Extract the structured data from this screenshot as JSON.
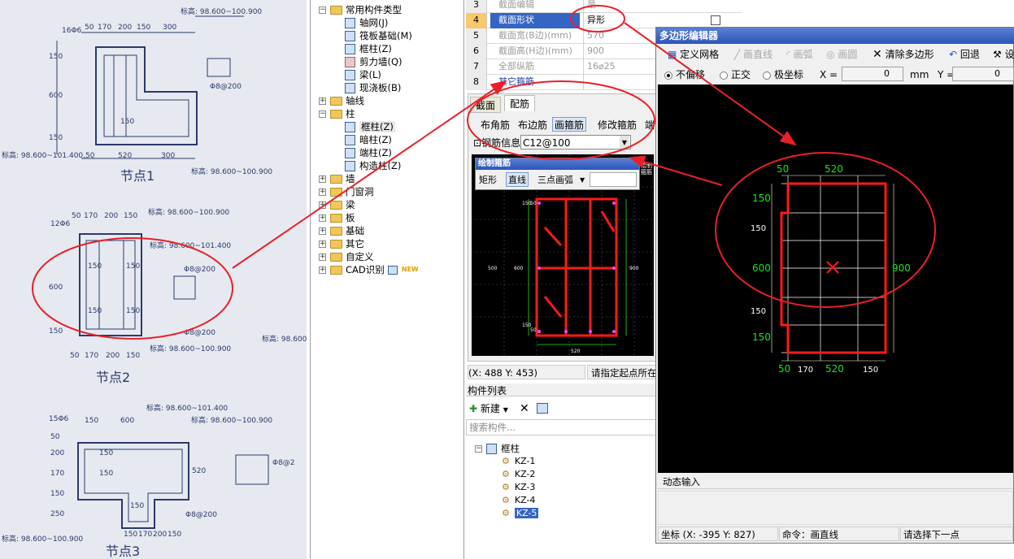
{
  "photo": {
    "node1_title": "节点1",
    "node2_title": "节点2",
    "node3_title": "节点3",
    "n1_top": [
      "16Φ6",
      "50",
      "170",
      "200",
      "150",
      "300"
    ],
    "n1_elev1": "标高: 98.600~100.900",
    "n1_elev2": "标高: 98.600~101.400,50",
    "n1_elev3": "标高: 98.600~100.900",
    "n1_left": [
      "150",
      "600",
      "150"
    ],
    "n1_stirrup": "Φ8@200",
    "n1_mid": "150",
    "n1_bottom": [
      "520",
      "300"
    ],
    "n2_top": [
      "12Φ6",
      "50",
      "170",
      "200",
      "150"
    ],
    "n2_elev1": "标高: 98.600~100.900",
    "n2_elev2": "标高: 98.600~101.400",
    "n2_elev3": "标高: 98.600~100.900",
    "n2_left": [
      "600",
      "150"
    ],
    "n2_inner": [
      "150",
      "150",
      "150",
      "150"
    ],
    "n2_stirrup1": "Φ8@200",
    "n2_stirrup2": "Φ8@200",
    "n2_bottom": [
      "50",
      "170",
      "200",
      "150"
    ],
    "n2_right": "标高: 98.600",
    "n3_top": [
      "15Φ6",
      "150",
      "600"
    ],
    "n3_elev1": "标高: 98.600~101.400",
    "n3_elev2": "标高: 98.600~100.900",
    "n3_left": [
      "50",
      "200",
      "170",
      "150",
      "250"
    ],
    "n3_inner": [
      "150",
      "150",
      "150"
    ],
    "n3_right": "520",
    "n3_stirrup": "Φ8@200",
    "n3_bottom": [
      "150",
      "170",
      "200",
      "150"
    ],
    "n3_elev3": "标高: 98.600~100.900",
    "n3_side": "Φ8@2"
  },
  "tree": {
    "root": "常用构件类型",
    "common": [
      "轴网(J)",
      "筏板基础(M)",
      "框柱(Z)",
      "剪力墙(Q)",
      "梁(L)",
      "现浇板(B)"
    ],
    "axis": "轴线",
    "column": "柱",
    "columns": [
      "框柱(Z)",
      "暗柱(Z)",
      "端柱(Z)",
      "构造柱(Z)"
    ],
    "others": [
      "墙",
      "门窗洞",
      "梁",
      "板",
      "基础",
      "其它",
      "自定义",
      "CAD识别"
    ],
    "new_badge": "NEW"
  },
  "props": {
    "rows": [
      {
        "n": "3",
        "name": "截面编辑",
        "val": "是"
      },
      {
        "n": "4",
        "name": "截面形状",
        "val": "异形"
      },
      {
        "n": "5",
        "name": "截面宽(B边)(mm)",
        "val": "570"
      },
      {
        "n": "6",
        "name": "截面高(H边)(mm)",
        "val": "900"
      },
      {
        "n": "7",
        "name": "全部纵筋",
        "val": "16⌀25"
      },
      {
        "n": "8",
        "name": "其它箍筋",
        "val": ""
      }
    ]
  },
  "editor": {
    "tabs": [
      "截面",
      "配筋"
    ],
    "tools": [
      "布角筋",
      "布边筋",
      "画箍筋",
      "修改箍筋",
      "端"
    ],
    "rebar_label": "钢筋信息",
    "rebar_value": "C12@100",
    "float_title": "绘制箍筋",
    "float_tools": [
      "矩形",
      "直线",
      "三点画弧"
    ],
    "float_side": "绘制箍筋",
    "canvas_dims": [
      "150",
      "50",
      "600",
      "150",
      "50",
      "900",
      "520",
      "500"
    ],
    "coord": "(X: 488 Y: 453)",
    "hint": "请指定起点所在"
  },
  "list": {
    "title": "构件列表",
    "new_label": "新建",
    "search_placeholder": "搜索构件...",
    "group": "框柱",
    "items": [
      "KZ-1",
      "KZ-2",
      "KZ-3",
      "KZ-4",
      "KZ-5"
    ]
  },
  "poly": {
    "title": "多边形编辑器",
    "toolbar": [
      "定义网格",
      "画直线",
      "画弧",
      "画圆",
      "清除多边形",
      "回退",
      "设"
    ],
    "modes": [
      "不偏移",
      "正交",
      "极坐标"
    ],
    "x_label": "X =",
    "x_value": "0",
    "unit": "mm",
    "y_label": "Y =",
    "y_value": "0",
    "dims_top": [
      "50",
      "520"
    ],
    "dims_left": [
      "150",
      "150",
      "600",
      "150",
      "150"
    ],
    "dim_right": "900",
    "dims_bottom": [
      "50",
      "170",
      "520",
      "150"
    ],
    "dynamic": "动态输入",
    "status_coord": "坐标 (X: -395 Y: 827)",
    "status_cmd": "命令：画直线",
    "status_hint": "请选择下一点"
  },
  "colors": {
    "annot": "#e8202a",
    "cad_green": "#22dd22",
    "shape": "#e8101a",
    "title_blue": "#2c55b8"
  }
}
